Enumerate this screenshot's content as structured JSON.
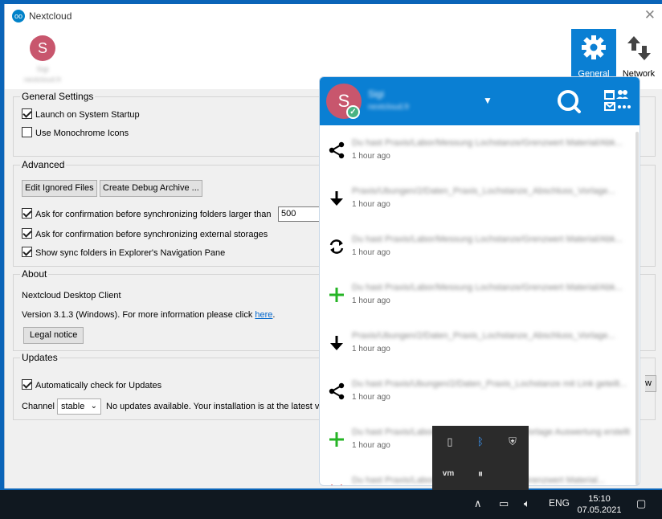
{
  "window": {
    "title": "Nextcloud",
    "close_glyph": "✕"
  },
  "toolbar": {
    "account_initial": "S",
    "account_name": "Sigi",
    "account_host": "nextcloud.fr",
    "general_label": "General",
    "network_label": "Network"
  },
  "general_settings": {
    "title": "General Settings",
    "launch_on_startup": {
      "label": "Launch on System Startup",
      "checked": true
    },
    "monochrome_icons": {
      "label": "Use Monochrome Icons",
      "checked": false
    }
  },
  "advanced": {
    "title": "Advanced",
    "edit_ignored_label": "Edit Ignored Files",
    "debug_archive_label": "Create Debug Archive ...",
    "ask_large_folders": {
      "label": "Ask for confirmation before synchronizing folders larger than",
      "checked": true
    },
    "folder_size_value": "500",
    "ask_external": {
      "label": "Ask for confirmation before synchronizing external storages",
      "checked": true
    },
    "show_sync_folders": {
      "label": "Show sync folders in Explorer's Navigation Pane",
      "checked": true
    }
  },
  "about": {
    "title": "About",
    "product": "Nextcloud Desktop Client",
    "version_prefix": "Version 3.1.3 (Windows). For more information please click ",
    "here_link": "here",
    "version_suffix": ".",
    "legal_notice_label": "Legal notice"
  },
  "updates": {
    "title": "Updates",
    "auto_check": {
      "label": "Automatically check for Updates",
      "checked": true
    },
    "channel_label": "Channel",
    "channel_value": "stable",
    "status_text": "No updates available. Your installation is at the latest ve",
    "right_button_fragment": "w"
  },
  "tray": {
    "avatar_initial": "S",
    "user_name": "Sigi",
    "user_host": "nextcloud.fr",
    "dropdown_glyph": "▼",
    "activities": [
      {
        "icon": "share-icon",
        "glyph": "⟨",
        "text": "Du hast Praxis/Labor/Messung Lochstanze/Grenzwert Material/Abk...",
        "time": "1 hour ago",
        "color": "#000000"
      },
      {
        "icon": "download-arrow-icon",
        "glyph": "↓",
        "text": "Praxis/Ubungen/2/Daten_Praxis_Lochstanze_Abschluss_Vorlage...",
        "time": "1 hour ago",
        "color": "#000000"
      },
      {
        "icon": "sync-icon",
        "glyph": "⟳",
        "text": "Du hast Praxis/Labor/Messung Lochstanze/Grenzwert Material/Abk...",
        "time": "1 hour ago",
        "color": "#000000"
      },
      {
        "icon": "plus-icon",
        "glyph": "+",
        "text": "Du hast Praxis/Labor/Messung Lochstanze/Grenzwert Material/Abk...",
        "time": "1 hour ago",
        "color": "#25b425"
      },
      {
        "icon": "download-arrow-icon",
        "glyph": "↓",
        "text": "Praxis/Ubungen/2/Daten_Praxis_Lochstanze_Abschluss_Vorlage...",
        "time": "1 hour ago",
        "color": "#000000"
      },
      {
        "icon": "share-icon",
        "glyph": "⟨",
        "text": "Du hast Praxis/Ubungen/2/Daten_Praxis_Lochstanze mit Link geteilt...",
        "time": "1 hour ago",
        "color": "#000000"
      },
      {
        "icon": "plus-icon",
        "glyph": "+",
        "text": "Du hast Praxis/Labor/Messung Lochstanze/Vorlage Auswertung erstellt",
        "time": "1 hour ago",
        "color": "#25b425"
      },
      {
        "icon": "chevron-down-icon",
        "glyph": "⌄",
        "text": "Du hast Praxis/Labor/Messung Lochstanze/Grenzwert Material...",
        "time": "",
        "color": "#dd3333"
      }
    ]
  },
  "taskbar": {
    "language": "ENG",
    "time": "15:10",
    "date": "07.05.2021"
  }
}
